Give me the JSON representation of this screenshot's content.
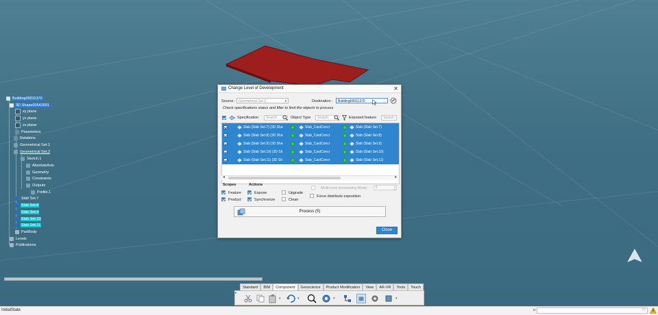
{
  "dialog": {
    "title": "Change Level of Development",
    "close_glyph": "✕",
    "source_label": "Source :",
    "source_value": "Geometrical Set.2",
    "destination_label": "Destination :",
    "destination_value": "Building00011370",
    "hint": "Check specifications status and filter to limit the objects to process",
    "columns": {
      "specification": "Specification",
      "object_type": "Object Type",
      "exposed_feature": "Exposed feature"
    },
    "search_placeholder": "Search",
    "rows": [
      {
        "spec": "Slab (Slab Set.7) (3D Sha",
        "type": "Slab_CastConcr",
        "exposed": "Slab (Slab Set.7)"
      },
      {
        "spec": "Slab (Slab Set.8) (3D Sha",
        "type": "Slab_CastConcr",
        "exposed": "Slab (Slab Set.8)"
      },
      {
        "spec": "Slab (Slab Set.9) (3D Sha",
        "type": "Slab_CastConcr",
        "exposed": "Slab (Slab Set.9)"
      },
      {
        "spec": "Slab (Slab Set.10) (3D Sh",
        "type": "Slab_CastConcr",
        "exposed": "Slab (Slab Set.10)"
      },
      {
        "spec": "Slab (Slab Set.11) (3D Sh",
        "type": "Slab_CastConcr",
        "exposed": "Slab (Slab Set.11)"
      }
    ],
    "scopes_label": "Scopes",
    "actions_label": "Actions",
    "scope_feature": "Feature",
    "scope_product": "Product",
    "action_expose": "Expose",
    "action_synchronize": "Synchronize",
    "action_upgrade": "Upgrade",
    "action_clean": "Clean",
    "multicore_label": "Multi-core processing Mode",
    "multicore_value": "6",
    "force_label": "Force distribute exposition",
    "process_button": "Process (5)",
    "close_button": "Close"
  },
  "tree": {
    "root": "Building00011370",
    "shape": "3D Shape00542601",
    "xy": "xy plane",
    "yz": "yz plane",
    "zx": "zx plane",
    "parameters": "Parameters",
    "relations": "Relations",
    "geoset1": "Geometrical Set.1",
    "geoset2": "Geometrical Set.2",
    "sketch1": "Sketch.1",
    "absaxis": "AbsoluteAxis",
    "geometry": "Geometry",
    "constraints": "Constraints",
    "outputs": "Outputs",
    "profile1": "Profile.1",
    "slab7": "Slab Set.7",
    "slab8": "Slab Set.8",
    "slab9": "Slab Set.9",
    "slab10": "Slab Set.10",
    "slab11": "Slab Set.11",
    "partbody": "PartBody",
    "levels": "Levels",
    "publications": "Publications"
  },
  "toolbar_tabs": [
    "Standard",
    "BIM",
    "Component",
    "Geoscience",
    "Product Modification",
    "View",
    "AR-VR",
    "Tools",
    "Touch"
  ],
  "active_tab": "Component",
  "status": {
    "text": "InitialState",
    "cmd_prefix": "c:"
  },
  "colors": {
    "selection_blue": "#2f86d0",
    "highlight_cyan": "#17c6d6",
    "slab_red": "#9e1d1d",
    "status_green": "#38d438",
    "background": "#3f6f84"
  }
}
